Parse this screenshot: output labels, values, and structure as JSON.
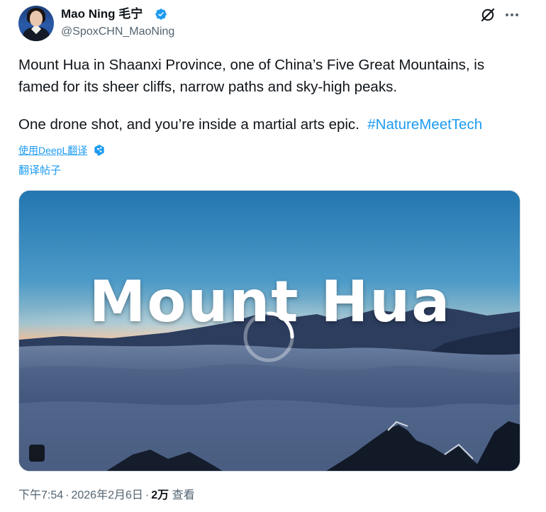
{
  "tweet": {
    "author": {
      "display_name": "Mao Ning 毛宁",
      "handle": "@SpoxCHN_MaoNing",
      "verified": true,
      "verified_color": "#1d9bf0"
    },
    "text": {
      "paragraph1_line1": "Mount Hua in Shaanxi Province, one of China’s Five Great Mountains, is",
      "paragraph1_line2": "famed for its sheer cliffs, narrow paths and sky-high peaks.",
      "paragraph2": "One drone shot, and you’re inside a martial arts epic.",
      "hashtag": "#NatureMeetTech"
    },
    "deepl_label": "使用DeepL翻译",
    "translate_label": "翻译帖子",
    "media": {
      "title_text": "Mount Hua",
      "type": "video",
      "state": "loading"
    },
    "meta": {
      "time": "下午7:54",
      "separator": "·",
      "date": "2026年2月6日",
      "views_count": "2万",
      "views_label": "查看"
    },
    "icons": {
      "header_right": [
        "grok-icon",
        "more-icon"
      ],
      "verified": "verified-badge-icon",
      "deepl": "deepl-icon"
    },
    "colors": {
      "link": "#1d9bf0",
      "secondary_text": "#536471",
      "primary_text": "#0f1419"
    }
  }
}
